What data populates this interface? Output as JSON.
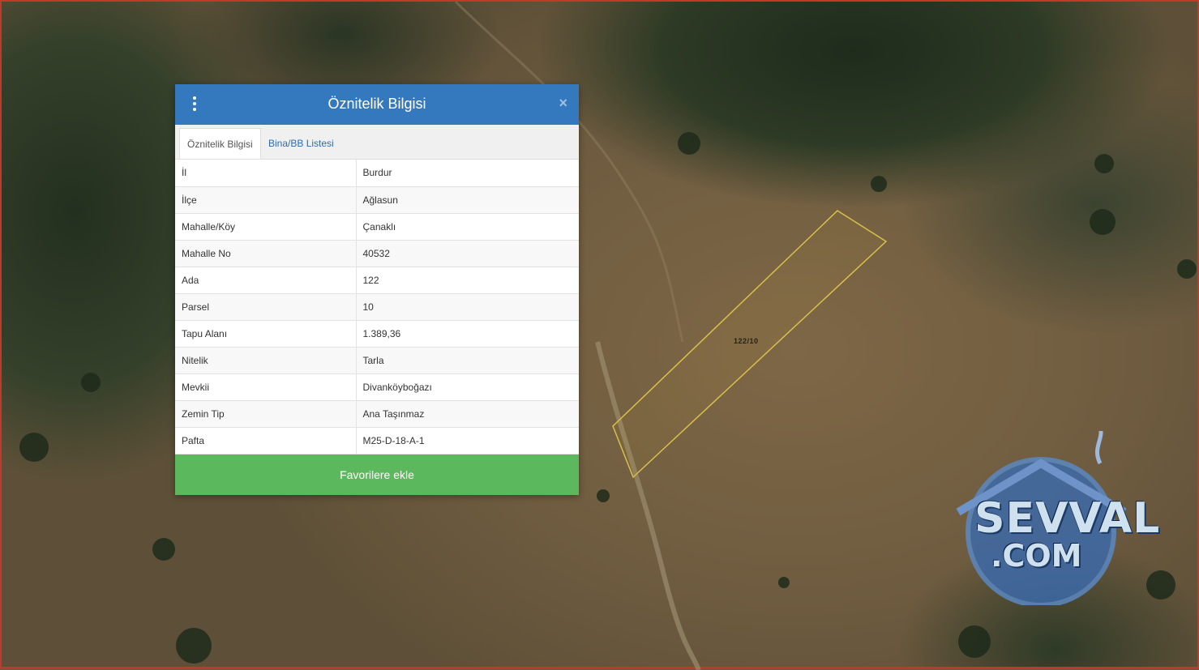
{
  "map": {
    "parcel_label": "122/10",
    "parcel_outline_color": "#d8c04a",
    "frame_color": "#c0392b"
  },
  "watermark": {
    "line1": "SEVVAL",
    "line2": ".COM"
  },
  "popup": {
    "title": "Öznitelik Bilgisi",
    "menu_icon": "vertical-ellipsis-icon",
    "close_label": "×",
    "header_color": "#3478be",
    "tabs": [
      {
        "label": "Öznitelik Bilgisi",
        "active": true
      },
      {
        "label": "Bina/BB Listesi",
        "active": false
      }
    ],
    "rows": [
      {
        "key": "İl",
        "value": "Burdur"
      },
      {
        "key": "İlçe",
        "value": "Ağlasun"
      },
      {
        "key": "Mahalle/Köy",
        "value": "Çanaklı"
      },
      {
        "key": "Mahalle No",
        "value": "40532"
      },
      {
        "key": "Ada",
        "value": "122"
      },
      {
        "key": "Parsel",
        "value": "10"
      },
      {
        "key": "Tapu Alanı",
        "value": "1.389,36"
      },
      {
        "key": "Nitelik",
        "value": "Tarla"
      },
      {
        "key": "Mevkii",
        "value": "Divanköyboğazı"
      },
      {
        "key": "Zemin Tip",
        "value": "Ana Taşınmaz"
      },
      {
        "key": "Pafta",
        "value": "M25-D-18-A-1"
      }
    ],
    "favorite_button": "Favorilere ekle",
    "favorite_color": "#5cb85c"
  }
}
